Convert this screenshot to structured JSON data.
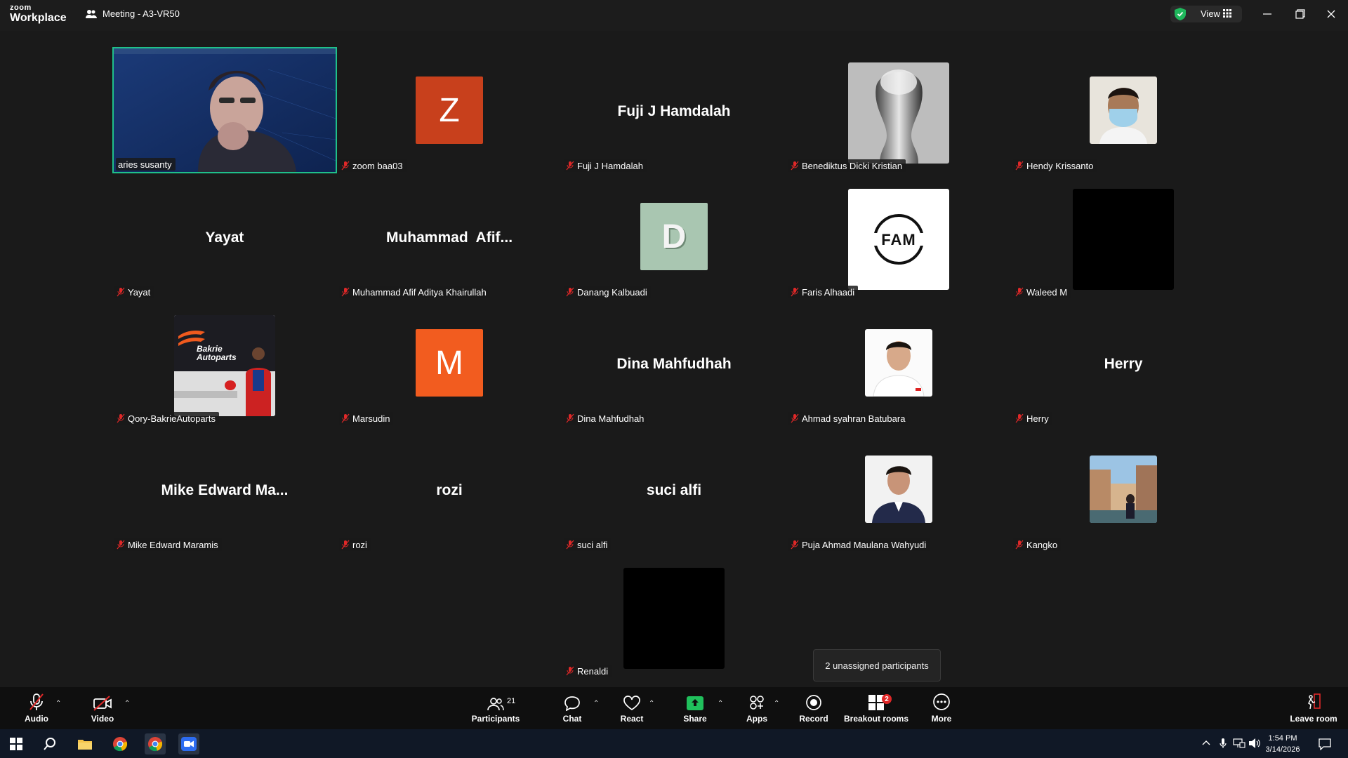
{
  "app": {
    "brand_small": "zoom",
    "brand_large": "Workplace",
    "meeting_title": "Meeting - A3-VR50",
    "view_label": "View"
  },
  "participants": [
    {
      "label": "aries susanty",
      "type": "video",
      "active": true
    },
    {
      "label": "zoom baa03",
      "type": "letter",
      "letter": "Z",
      "color": "#c8401c"
    },
    {
      "label": "Fuji J Hamdalah",
      "type": "name",
      "display": "Fuji J Hamdalah"
    },
    {
      "label": "Benediktus Dicki Kristian",
      "type": "photo",
      "photo": "trophy"
    },
    {
      "label": "Hendy Krissanto",
      "type": "photo",
      "photo": "masked-man"
    },
    {
      "label": "Yayat",
      "type": "name",
      "display": "Yayat"
    },
    {
      "label": "Muhammad Afif Aditya Khairullah",
      "type": "name",
      "display": "Muhammad  Afif..."
    },
    {
      "label": "Danang Kalbuadi",
      "type": "letter",
      "letter": "D",
      "color": "#a9c6b1"
    },
    {
      "label": "Faris Alhaadi",
      "type": "photo",
      "photo": "fam-logo",
      "logo_text": "FAM"
    },
    {
      "label": "Waleed M",
      "type": "photo",
      "photo": "black"
    },
    {
      "label": "Qory-BakrieAutoparts",
      "type": "photo",
      "photo": "bakrie",
      "logo_text": "Bakrie\nAutoparts"
    },
    {
      "label": "Marsudin",
      "type": "letter",
      "letter": "M",
      "color": "#f25c1f"
    },
    {
      "label": "Dina Mahfudhah",
      "type": "name",
      "display": "Dina Mahfudhah"
    },
    {
      "label": "Ahmad syahran Batubara",
      "type": "photo",
      "photo": "portrait-white"
    },
    {
      "label": "Herry",
      "type": "name",
      "display": "Herry"
    },
    {
      "label": "Mike Edward Maramis",
      "type": "name",
      "display": "Mike Edward Ma..."
    },
    {
      "label": "rozi",
      "type": "name",
      "display": "rozi"
    },
    {
      "label": "suci alfi",
      "type": "name",
      "display": "suci alfi"
    },
    {
      "label": "Puja Ahmad Maulana Wahyudi",
      "type": "photo",
      "photo": "portrait-suit"
    },
    {
      "label": "Kangko",
      "type": "photo",
      "photo": "venice"
    },
    {
      "label": "Renaldi",
      "type": "photo",
      "photo": "black"
    }
  ],
  "tooltip": "2 unassigned participants",
  "toolbar": {
    "audio": "Audio",
    "video": "Video",
    "participants": "Participants",
    "participants_count": "21",
    "chat": "Chat",
    "react": "React",
    "share": "Share",
    "apps": "Apps",
    "record": "Record",
    "breakout": "Breakout rooms",
    "breakout_badge": "2",
    "more": "More",
    "leave": "Leave room"
  },
  "taskbar": {
    "time": "1:54 PM",
    "date": "3/14/2026"
  },
  "colors": {
    "active_border": "#1fc08a",
    "share_green": "#20c05c",
    "muted_red": "#e02828"
  }
}
